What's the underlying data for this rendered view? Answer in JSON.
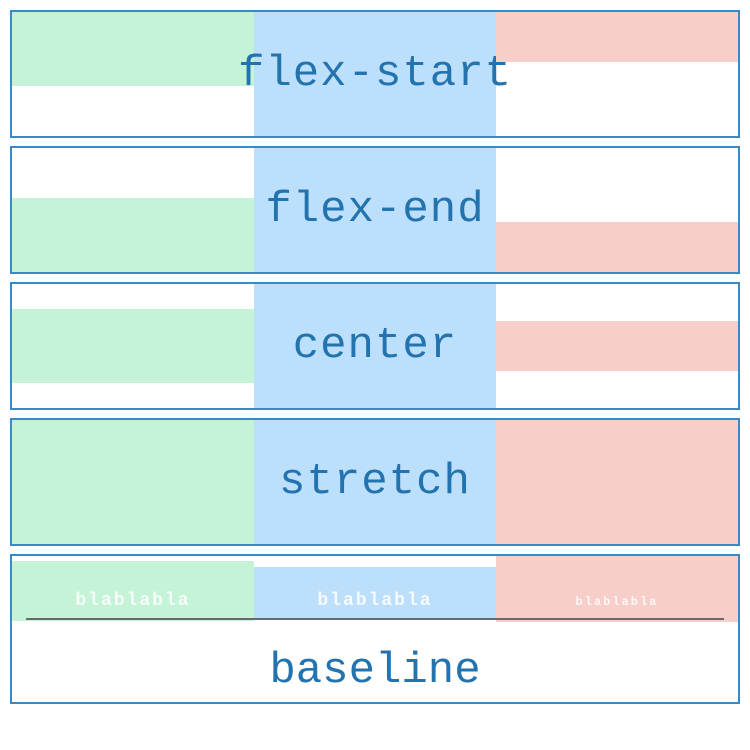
{
  "rows": [
    {
      "label": "flex-start"
    },
    {
      "label": "flex-end"
    },
    {
      "label": "center"
    },
    {
      "label": "stretch"
    },
    {
      "label": "baseline",
      "placeholder": "blablabla"
    }
  ]
}
